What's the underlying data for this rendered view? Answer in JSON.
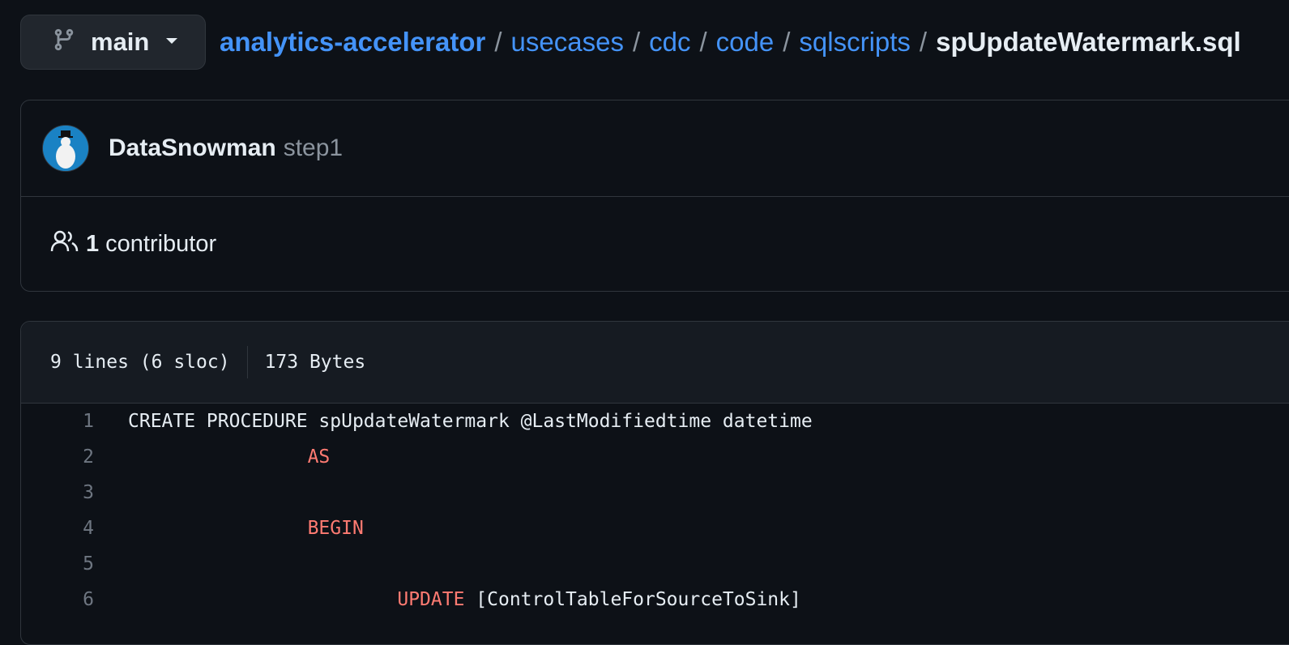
{
  "branch": {
    "name": "main",
    "icon": "git-branch-icon",
    "caret": "chevron-down-icon"
  },
  "breadcrumb": {
    "repo": "analytics-accelerator",
    "parts": [
      "usecases",
      "cdc",
      "code",
      "sqlscripts"
    ],
    "file": "spUpdateWatermark.sql",
    "separator": "/"
  },
  "commit": {
    "author": "DataSnowman",
    "message": "step1"
  },
  "contributors": {
    "icon": "people-icon",
    "count": "1",
    "label": "contributor"
  },
  "file": {
    "lines_info": "9 lines (6 sloc)",
    "size": "173 Bytes"
  },
  "code_lines": [
    {
      "n": "1",
      "indent": "",
      "kw": "",
      "text": "CREATE PROCEDURE spUpdateWatermark @LastModifiedtime datetime"
    },
    {
      "n": "2",
      "indent": "                ",
      "kw": "AS",
      "text": ""
    },
    {
      "n": "3",
      "indent": "",
      "kw": "",
      "text": ""
    },
    {
      "n": "4",
      "indent": "                ",
      "kw": "BEGIN",
      "text": ""
    },
    {
      "n": "5",
      "indent": "",
      "kw": "",
      "text": ""
    },
    {
      "n": "6",
      "indent": "                        ",
      "kw": "UPDATE",
      "text": " [ControlTableForSourceToSink]"
    }
  ],
  "colors": {
    "link": "#4493f8",
    "keyword": "#ff7b72",
    "background": "#0d1117"
  }
}
